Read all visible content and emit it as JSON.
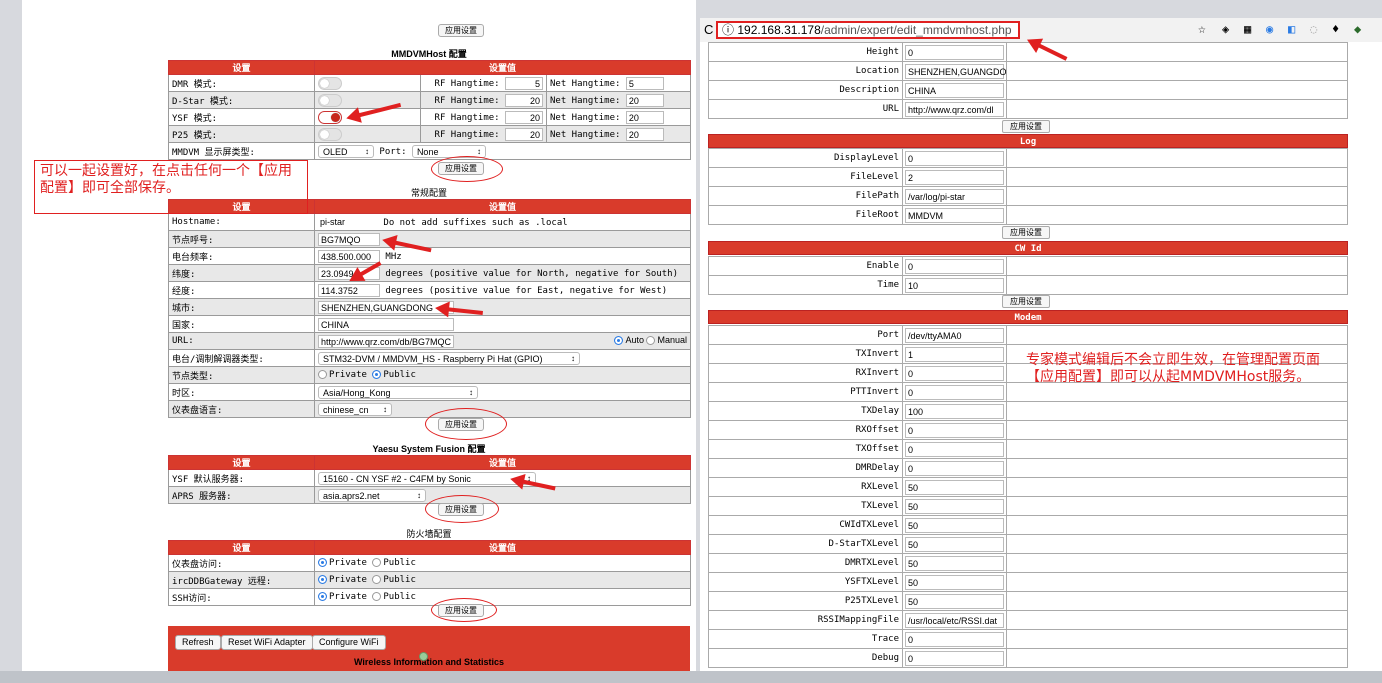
{
  "browser": {
    "url_host": "192.168.31.178",
    "url_path": "/admin/expert/edit_mmdvmhost.php",
    "info": "ⓘ",
    "reload": "C"
  },
  "left": {
    "apply": "应用设置",
    "mmdvm": {
      "title": "MMDVMHost 配置",
      "h1": "设置",
      "h2": "设置值",
      "rows": [
        {
          "label": "DMR 模式:",
          "rf": "RF Hangtime:",
          "rfv": "5",
          "net": "Net Hangtime:",
          "netv": "5"
        },
        {
          "label": "D-Star 模式:",
          "rf": "RF Hangtime:",
          "rfv": "20",
          "net": "Net Hangtime:",
          "netv": "20"
        },
        {
          "label": "YSF 模式:",
          "rf": "RF Hangtime:",
          "rfv": "20",
          "net": "Net Hangtime:",
          "netv": "20"
        },
        {
          "label": "P25 模式:",
          "rf": "RF Hangtime:",
          "rfv": "20",
          "net": "Net Hangtime:",
          "netv": "20"
        }
      ],
      "display_label": "MMDVM 显示屏类型:",
      "display": "OLED",
      "port_label": "Port:",
      "port": "None"
    },
    "general": {
      "title": "常规配置",
      "h1": "设置",
      "h2": "设置值",
      "hostname_label": "Hostname:",
      "hostname": "pi-star",
      "hostname_note": "Do not add suffixes such as .local",
      "callsign_label": "节点呼号:",
      "callsign": "BG7MQO",
      "freq_label": "电台频率:",
      "freq": "438.500.000",
      "freq_unit": "MHz",
      "lat_label": "纬度:",
      "lat": "23.0949",
      "lat_note": "degrees (positive value for North, negative for South)",
      "lon_label": "经度:",
      "lon": "114.3752",
      "lon_note": "degrees (positive value for East, negative for West)",
      "city_label": "城市:",
      "city": "SHENZHEN,GUANGDONG",
      "country_label": "国家:",
      "country": "CHINA",
      "url_label": "URL:",
      "url": "http://www.qrz.com/db/BG7MQC",
      "auto": "Auto",
      "manual": "Manual",
      "modem_label": "电台/调制解调器类型:",
      "modem": "STM32-DVM / MMDVM_HS - Raspberry Pi Hat (GPIO)",
      "nodetype_label": "节点类型:",
      "private": "Private",
      "public": "Public",
      "tz_label": "时区:",
      "tz": "Asia/Hong_Kong",
      "lang_label": "仪表盘语言:",
      "lang": "chinese_cn"
    },
    "ysf": {
      "title": "Yaesu System Fusion 配置",
      "h1": "设置",
      "h2": "设置值",
      "server_label": "YSF 默认服务器:",
      "server": "15160 - CN YSF #2 - C4FM by Sonic",
      "aprs_label": "APRS 服务器:",
      "aprs": "asia.aprs2.net"
    },
    "fw": {
      "title": "防火墙配置",
      "h1": "设置",
      "h2": "设置值",
      "rows": [
        {
          "label": "仪表盘访问:"
        },
        {
          "label": "ircDDBGateway 远程:"
        },
        {
          "label": "SSH访问:"
        }
      ],
      "private": "Private",
      "public": "Public"
    },
    "wifi": {
      "refresh": "Refresh",
      "reset": "Reset WiFi Adapter",
      "configure": "Configure WiFi",
      "stats": "Wireless Information and Statistics"
    },
    "note": "可以一起设置好，在点击任何一个【应用配置】即可全部保存。"
  },
  "right": {
    "apply": "应用设置",
    "general_rows": [
      {
        "k": "Height",
        "v": "0"
      },
      {
        "k": "Location",
        "v": "SHENZHEN,GUANGDO"
      },
      {
        "k": "Description",
        "v": "CHINA"
      },
      {
        "k": "URL",
        "v": "http://www.qrz.com/dl"
      }
    ],
    "log_title": "Log",
    "log_rows": [
      {
        "k": "DisplayLevel",
        "v": "0"
      },
      {
        "k": "FileLevel",
        "v": "2"
      },
      {
        "k": "FilePath",
        "v": "/var/log/pi-star"
      },
      {
        "k": "FileRoot",
        "v": "MMDVM"
      }
    ],
    "cw_title": "CW Id",
    "cw_rows": [
      {
        "k": "Enable",
        "v": "0"
      },
      {
        "k": "Time",
        "v": "10"
      }
    ],
    "modem_title": "Modem",
    "modem_rows": [
      {
        "k": "Port",
        "v": "/dev/ttyAMA0"
      },
      {
        "k": "TXInvert",
        "v": "1"
      },
      {
        "k": "RXInvert",
        "v": "0"
      },
      {
        "k": "PTTInvert",
        "v": "0"
      },
      {
        "k": "TXDelay",
        "v": "100"
      },
      {
        "k": "RXOffset",
        "v": "0"
      },
      {
        "k": "TXOffset",
        "v": "0"
      },
      {
        "k": "DMRDelay",
        "v": "0"
      },
      {
        "k": "RXLevel",
        "v": "50"
      },
      {
        "k": "TXLevel",
        "v": "50"
      },
      {
        "k": "CWIdTXLevel",
        "v": "50"
      },
      {
        "k": "D-StarTXLevel",
        "v": "50"
      },
      {
        "k": "DMRTXLevel",
        "v": "50"
      },
      {
        "k": "YSFTXLevel",
        "v": "50"
      },
      {
        "k": "P25TXLevel",
        "v": "50"
      },
      {
        "k": "RSSIMappingFile",
        "v": "/usr/local/etc/RSSI.dat"
      },
      {
        "k": "Trace",
        "v": "0"
      },
      {
        "k": "Debug",
        "v": "0"
      }
    ],
    "note": "专家模式编辑后不会立即生效，在管理配置页面【应用配置】即可以从起MMDVMHost服务。"
  }
}
